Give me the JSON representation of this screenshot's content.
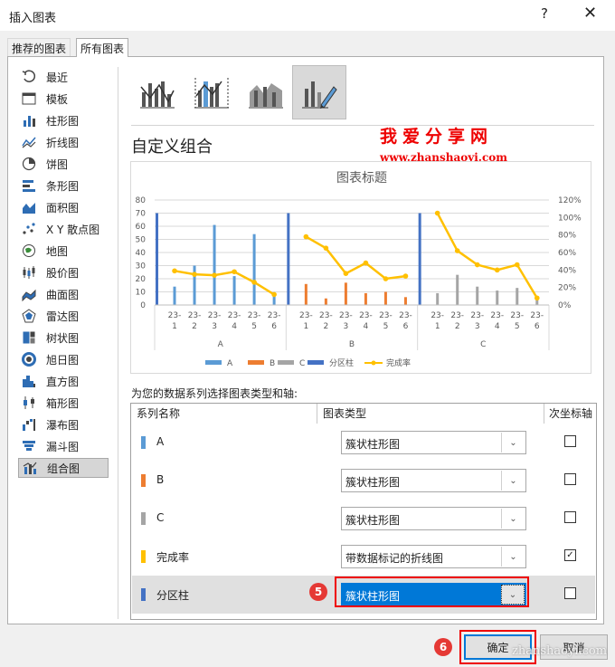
{
  "window": {
    "title": "插入图表",
    "help_glyph": "?",
    "close_glyph": "✕"
  },
  "tabs": [
    {
      "label": "推荐的图表",
      "active": false
    },
    {
      "label": "所有图表",
      "active": true
    }
  ],
  "sidebar": {
    "items": [
      {
        "label": "最近",
        "icon": "recent-icon"
      },
      {
        "label": "模板",
        "icon": "template-icon"
      },
      {
        "label": "柱形图",
        "icon": "column-chart-icon"
      },
      {
        "label": "折线图",
        "icon": "line-chart-icon"
      },
      {
        "label": "饼图",
        "icon": "pie-chart-icon"
      },
      {
        "label": "条形图",
        "icon": "bar-chart-icon"
      },
      {
        "label": "面积图",
        "icon": "area-chart-icon"
      },
      {
        "label": "X Y 散点图",
        "icon": "scatter-chart-icon"
      },
      {
        "label": "地图",
        "icon": "map-chart-icon"
      },
      {
        "label": "股价图",
        "icon": "stock-chart-icon"
      },
      {
        "label": "曲面图",
        "icon": "surface-chart-icon"
      },
      {
        "label": "雷达图",
        "icon": "radar-chart-icon"
      },
      {
        "label": "树状图",
        "icon": "treemap-chart-icon"
      },
      {
        "label": "旭日图",
        "icon": "sunburst-chart-icon"
      },
      {
        "label": "直方图",
        "icon": "histogram-chart-icon"
      },
      {
        "label": "箱形图",
        "icon": "boxplot-chart-icon"
      },
      {
        "label": "瀑布图",
        "icon": "waterfall-chart-icon"
      },
      {
        "label": "漏斗图",
        "icon": "funnel-chart-icon"
      },
      {
        "label": "组合图",
        "icon": "combo-chart-icon"
      }
    ],
    "selected_index": 18
  },
  "combo_types": [
    {
      "icon": "clustered-column-line-icon"
    },
    {
      "icon": "clustered-column-line-secondary-icon"
    },
    {
      "icon": "stacked-area-column-icon"
    },
    {
      "icon": "custom-combo-icon"
    }
  ],
  "section_title": "自定义组合",
  "watermark": {
    "line1": "我爱分享网",
    "line2": "www.zhanshaoyi.com",
    "corner": "zhanshaoyi.com"
  },
  "chart_data": {
    "type": "bar",
    "title": "图表标题",
    "groups": [
      "A",
      "B",
      "C"
    ],
    "category_labels": [
      [
        "23-",
        "1"
      ],
      [
        "23-",
        "2"
      ],
      [
        "23-",
        "3"
      ],
      [
        "23-",
        "4"
      ],
      [
        "23-",
        "5"
      ],
      [
        "23-",
        "6"
      ]
    ],
    "ylim": [
      0,
      80
    ],
    "y_ticks": [
      0,
      10,
      20,
      30,
      40,
      50,
      60,
      70,
      80
    ],
    "y2lim": [
      0,
      1.2
    ],
    "y2_ticks": [
      "0%",
      "20%",
      "40%",
      "60%",
      "80%",
      "100%",
      "120%"
    ],
    "series": [
      {
        "name": "A",
        "kind": "bar",
        "color": "#5b9bd5",
        "group": 0,
        "values": [
          14,
          30,
          61,
          22,
          54,
          7
        ]
      },
      {
        "name": "B",
        "kind": "bar",
        "color": "#ed7d31",
        "group": 1,
        "values": [
          16,
          5,
          17,
          9,
          10,
          6
        ]
      },
      {
        "name": "C",
        "kind": "bar",
        "color": "#a5a5a5",
        "group": 2,
        "values": [
          9,
          23,
          14,
          11,
          13,
          6
        ]
      },
      {
        "name": "分区柱",
        "kind": "divider",
        "color": "#4472c4",
        "values": [
          70,
          70,
          70
        ]
      },
      {
        "name": "完成率",
        "kind": "line",
        "color": "#ffc000",
        "axis": "secondary",
        "values": [
          [
            0.39,
            0.35,
            0.34,
            0.38,
            0.26,
            0.12
          ],
          [
            0.78,
            0.65,
            0.36,
            0.48,
            0.3,
            0.33
          ],
          [
            1.05,
            0.62,
            0.46,
            0.4,
            0.46,
            0.08
          ]
        ]
      }
    ],
    "legend": [
      "A",
      "B",
      "C",
      "分区柱",
      "完成率"
    ],
    "legend_position": "bottom",
    "grid": true
  },
  "prompt": "为您的数据系列选择图表类型和轴:",
  "table": {
    "headers": [
      "系列名称",
      "图表类型",
      "次坐标轴"
    ],
    "rows": [
      {
        "name": "A",
        "color": "#5b9bd5",
        "type": "簇状柱形图",
        "secondary": false
      },
      {
        "name": "B",
        "color": "#ed7d31",
        "type": "簇状柱形图",
        "secondary": false
      },
      {
        "name": "C",
        "color": "#a5a5a5",
        "type": "簇状柱形图",
        "secondary": false
      },
      {
        "name": "完成率",
        "color": "#ffc000",
        "type": "带数据标记的折线图",
        "secondary": true
      },
      {
        "name": "分区柱",
        "color": "#4472c4",
        "type": "簇状柱形图",
        "secondary": false
      }
    ]
  },
  "annotations": {
    "step5": "5",
    "step6": "6"
  },
  "buttons": {
    "ok": "确定",
    "cancel": "取消"
  }
}
